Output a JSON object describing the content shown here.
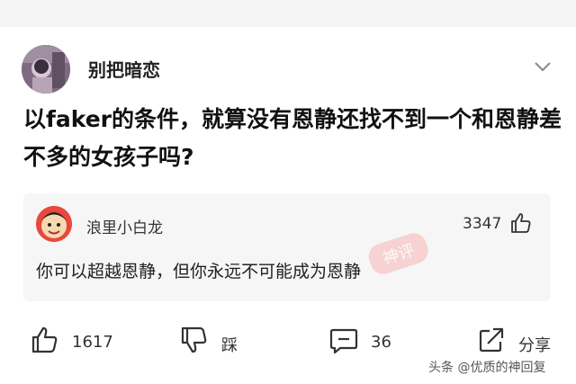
{
  "post": {
    "author": {
      "name": "别把暗恋",
      "avatar_icon": "user-avatar"
    },
    "question": "以faker的条件，就算没有恩静还找不到一个和恩静差不多的女孩子吗?"
  },
  "reply": {
    "author": "浪里小白龙",
    "likes": "3347",
    "text": "你可以超越恩静，但你永远不可能成为恩静",
    "stamp_text": "神评"
  },
  "actions": {
    "like_count": "1617",
    "dislike_label": "踩",
    "comment_count": "36",
    "share_label": "分享"
  },
  "watermark": "头条 @优质的神回复",
  "colors": {
    "stamp": "#f26a6a",
    "icon": "#333333"
  }
}
